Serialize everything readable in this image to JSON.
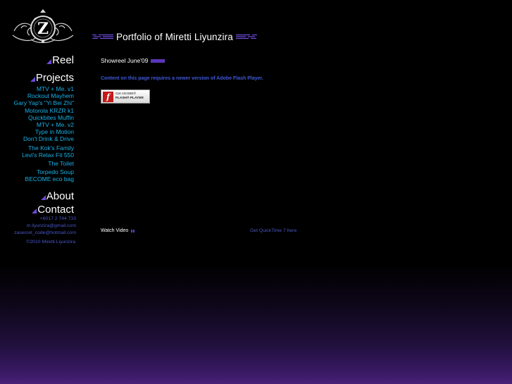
{
  "header": {
    "title": "Portfolio of Miretti Liyunzira"
  },
  "logo": {
    "icon": "ornate-z-crest-icon",
    "letter": "Z"
  },
  "nav": {
    "reel": "Reel",
    "projects": "Projects",
    "about": "About",
    "contact": "Contact"
  },
  "projects": [
    "MTV + Me. v1",
    "Rockout Mayhem",
    "Gary Yap's \"Yi Bei Zhi\"",
    "Motorola KRZR k1",
    "Quickbites Muffin",
    "MTV + Me. v2",
    "Type in Motion",
    "Don't Drink & Drive",
    "The Kok's Family",
    "Levi's Relax Fit 550",
    "The Toilet",
    "Torpedo Soup",
    "BECOME eco bag"
  ],
  "contact": {
    "phone": "+6017 2 744 733",
    "email1": "m.liyunzira@gmail.com",
    "email2": "zasecret_code@hotmail.com"
  },
  "copyright": "©2010 Miretti Liyunzira",
  "main": {
    "showreel_label": "Showreel June'09",
    "flash_message": "Content on this page requires a newer version of Adobe Flash Player.",
    "flash_badge_line1": "Get ADOBE®",
    "flash_badge_line2": "FLASH® PLAYER",
    "watch_video": "Watch Video",
    "quicktime": "Get QuickTime 7 here"
  },
  "colors": {
    "accent_purple": "#5a36b8",
    "link_cyan": "#19b0e6",
    "link_blue": "#4a58c8"
  }
}
